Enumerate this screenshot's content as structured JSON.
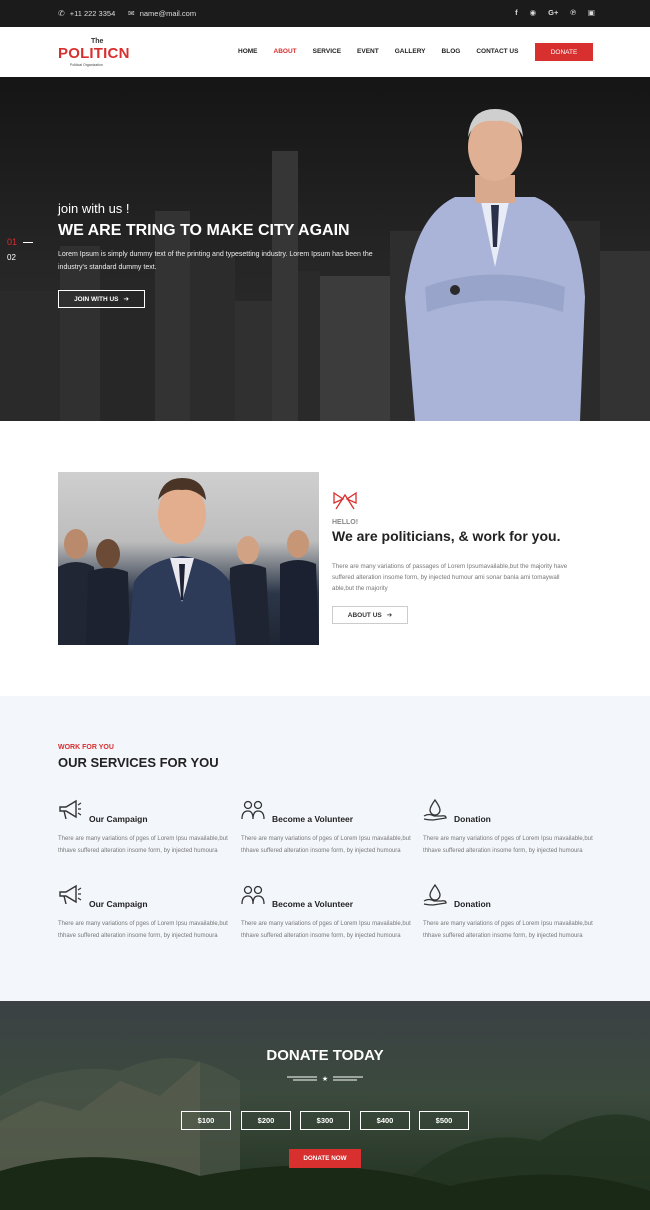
{
  "topbar": {
    "phone": "+11 222 3354",
    "email": "name@mail.com",
    "social": [
      "f",
      "rss",
      "g+",
      "p",
      "ig"
    ]
  },
  "header": {
    "logo_the": "The",
    "logo_name": "POLITICN",
    "logo_sub": "Political Organization",
    "menu": [
      "HOME",
      "ABOUT",
      "SERVICE",
      "EVENT",
      "GALLERY",
      "BLOG",
      "CONTACT US"
    ],
    "active_menu": "ABOUT",
    "donate_label": "DONATE"
  },
  "hero": {
    "slide_current": "01",
    "slide_next": "02",
    "subtitle": "join with us !",
    "title": "WE ARE TRING TO MAKE CITY AGAIN",
    "description": "Lorem Ipsum is simply dummy text of the printing and typesetting industry. Lorem Ipsum has been the industry's standard dummy text.",
    "button": "JOIN WITH US"
  },
  "about": {
    "tag": "HELLO!",
    "title": "We are politicians, & work for you.",
    "text": "There are many variations of passages of Lorem Ipsumavailable,but the majority have suffered alteration insome form, by injected humour ami sonar banla ami tomaywall able,but the majority",
    "button": "ABOUT US"
  },
  "services": {
    "tag": "WORK FOR YOU",
    "title": "OUR SERVICES FOR YOU",
    "items": [
      {
        "title": "Our Campaign",
        "icon": "megaphone-icon",
        "text": "There are many variations of pges of Lorem Ipsu mavailable,but thhave suffered alteration insome form, by injected humoura"
      },
      {
        "title": "Become a Volunteer",
        "icon": "volunteer-icon",
        "text": "There are many variations of pges of Lorem Ipsu mavailable,but thhave suffered alteration insome form, by injected humoura"
      },
      {
        "title": "Donation",
        "icon": "donation-icon",
        "text": "There are many variations of pges of Lorem Ipsu mavailable,but thhave suffered alteration insome form, by injected humoura"
      },
      {
        "title": "Our Campaign",
        "icon": "megaphone-icon",
        "text": "There are many variations of pges of Lorem Ipsu mavailable,but thhave suffered alteration insome form, by injected humoura"
      },
      {
        "title": "Become a Volunteer",
        "icon": "volunteer-icon",
        "text": "There are many variations of pges of Lorem Ipsu mavailable,but thhave suffered alteration insome form, by injected humoura"
      },
      {
        "title": "Donation",
        "icon": "donation-icon",
        "text": "There are many variations of pges of Lorem Ipsu mavailable,but thhave suffered alteration insome form, by injected humoura"
      }
    ]
  },
  "donate": {
    "title": "DONATE TODAY",
    "amounts": [
      "$100",
      "$200",
      "$300",
      "$400",
      "$500"
    ],
    "button": "DONATE NOW"
  },
  "colors": {
    "accent": "#d82f2f",
    "dark": "#1b1b1b",
    "light_bg": "#f3f6fb"
  }
}
